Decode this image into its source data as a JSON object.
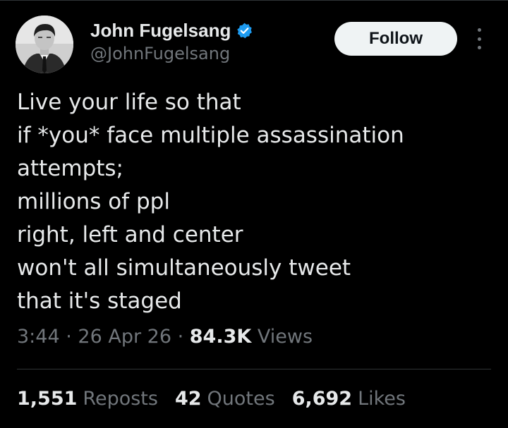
{
  "author": {
    "display_name": "John Fugelsang",
    "handle": "@JohnFugelsang",
    "verified_icon": "verified-badge-icon",
    "verified_color": "#1d9bf0"
  },
  "actions": {
    "follow_label": "Follow",
    "more_icon": "more-vertical-icon"
  },
  "tweet": {
    "lines": [
      "Live your life so that",
      "if *you* face multiple assassination",
      "attempts;",
      "millions of ppl",
      "right, left and center",
      "won't all simultaneously tweet",
      "that it's staged"
    ]
  },
  "meta": {
    "time": "3:44",
    "separator": "·",
    "date": "26 Apr 26",
    "views_count": "84.3K",
    "views_label": "Views"
  },
  "stats": {
    "reposts_count": "1,551",
    "reposts_label": "Reposts",
    "quotes_count": "42",
    "quotes_label": "Quotes",
    "likes_count": "6,692",
    "likes_label": "Likes"
  },
  "colors": {
    "background": "#000000",
    "text_primary": "#e7e9ea",
    "text_secondary": "#71767b",
    "divider": "#2f3336",
    "button_bg": "#eff3f4"
  }
}
